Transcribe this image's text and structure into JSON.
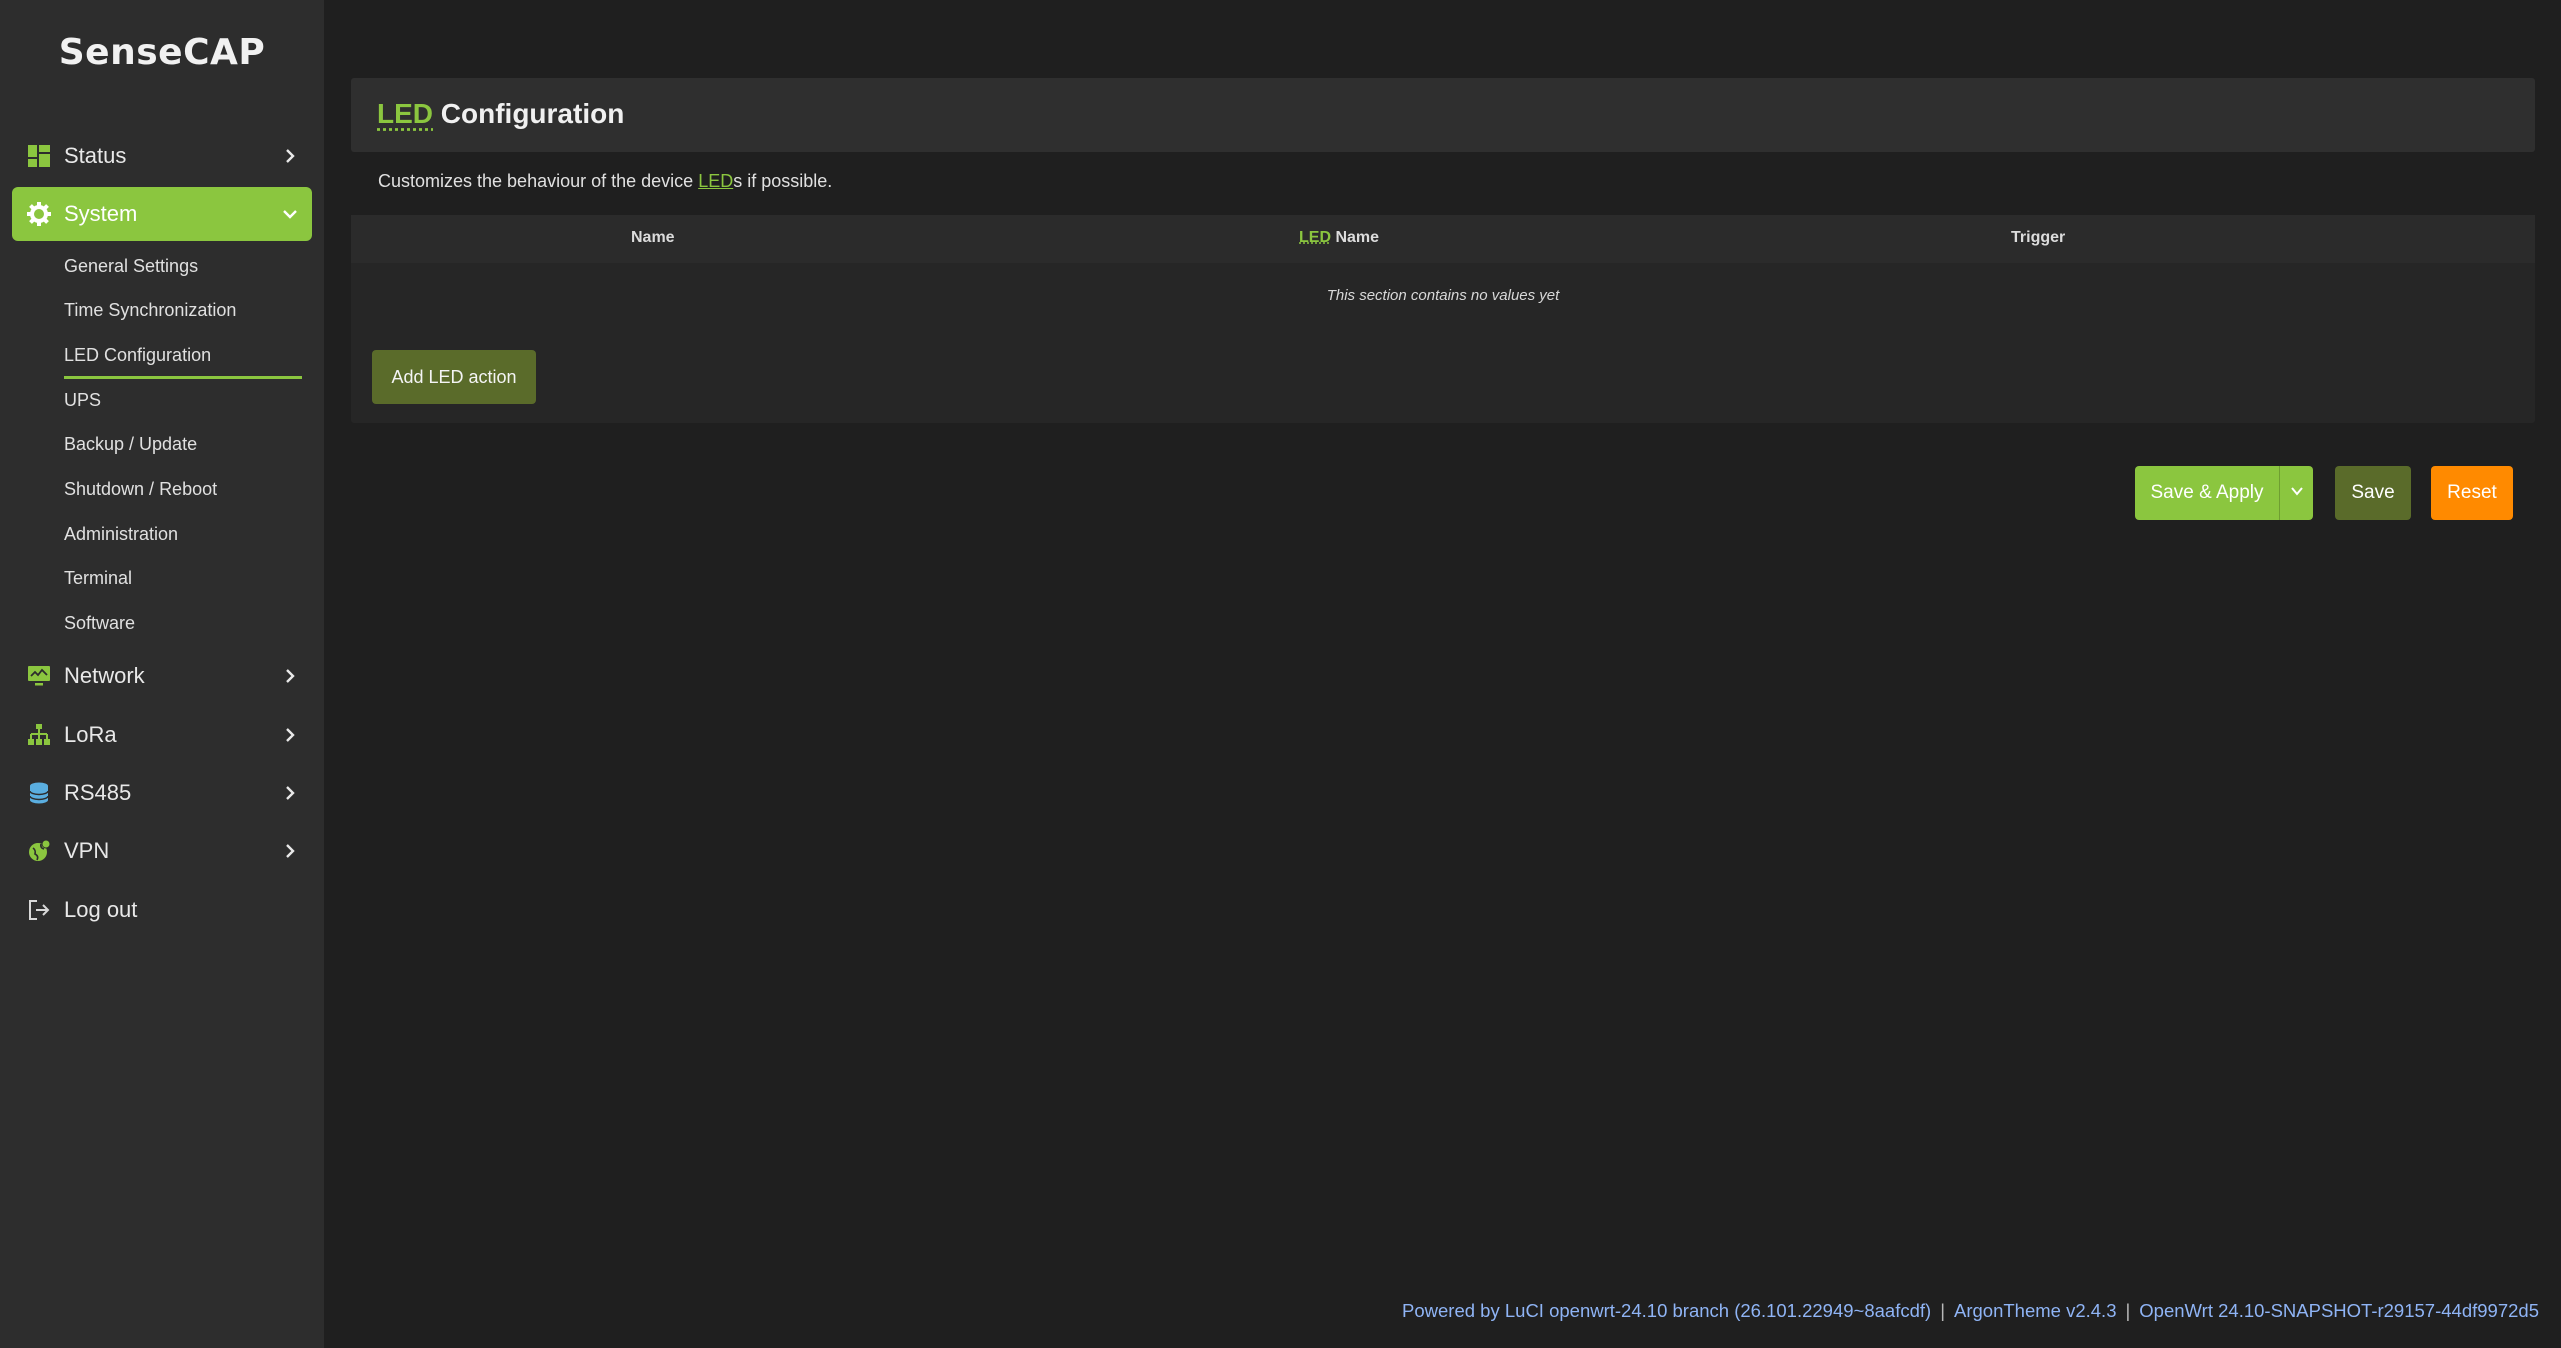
{
  "brand": {
    "name": "SenseCAP"
  },
  "sidebar": {
    "items": [
      {
        "label": "Status",
        "icon": "dashboard-icon"
      },
      {
        "label": "System",
        "icon": "gear-icon"
      },
      {
        "label": "Network",
        "icon": "monitor-icon"
      },
      {
        "label": "LoRa",
        "icon": "sitemap-icon"
      },
      {
        "label": "RS485",
        "icon": "database-icon"
      },
      {
        "label": "VPN",
        "icon": "globe-icon"
      },
      {
        "label": "Log out",
        "icon": "logout-icon"
      }
    ],
    "system_submenu": [
      "General Settings",
      "Time Synchronization",
      "LED Configuration",
      "UPS",
      "Backup / Update",
      "Shutdown / Reboot",
      "Administration",
      "Terminal",
      "Software"
    ]
  },
  "page": {
    "title_abbr": "LED",
    "title_rest": "Configuration",
    "desc_before": "Customizes the behaviour of the device ",
    "desc_abbr": "LED",
    "desc_after": "s if possible."
  },
  "table": {
    "col_name": "Name",
    "col_led_abbr": "LED",
    "col_led_rest": "Name",
    "col_trigger": "Trigger",
    "empty_message": "This section contains no values yet",
    "add_button": "Add LED action"
  },
  "actions": {
    "save_apply": "Save & Apply",
    "save": "Save",
    "reset": "Reset"
  },
  "footer": {
    "luci": "Powered by LuCI openwrt-24.10 branch (26.101.22949~8aafcdf)",
    "theme": "ArgonTheme v2.4.3",
    "openwrt": "OpenWrt 24.10-SNAPSHOT-r29157-44df9972d5",
    "separator": "|"
  },
  "colors": {
    "accent": "#8bc63f",
    "sidebar_bg": "#2d2d2d",
    "main_bg": "#1f1f1f",
    "reset": "#ff8a00",
    "save": "#5a6b2a",
    "footer_link": "#8fb4f5"
  }
}
